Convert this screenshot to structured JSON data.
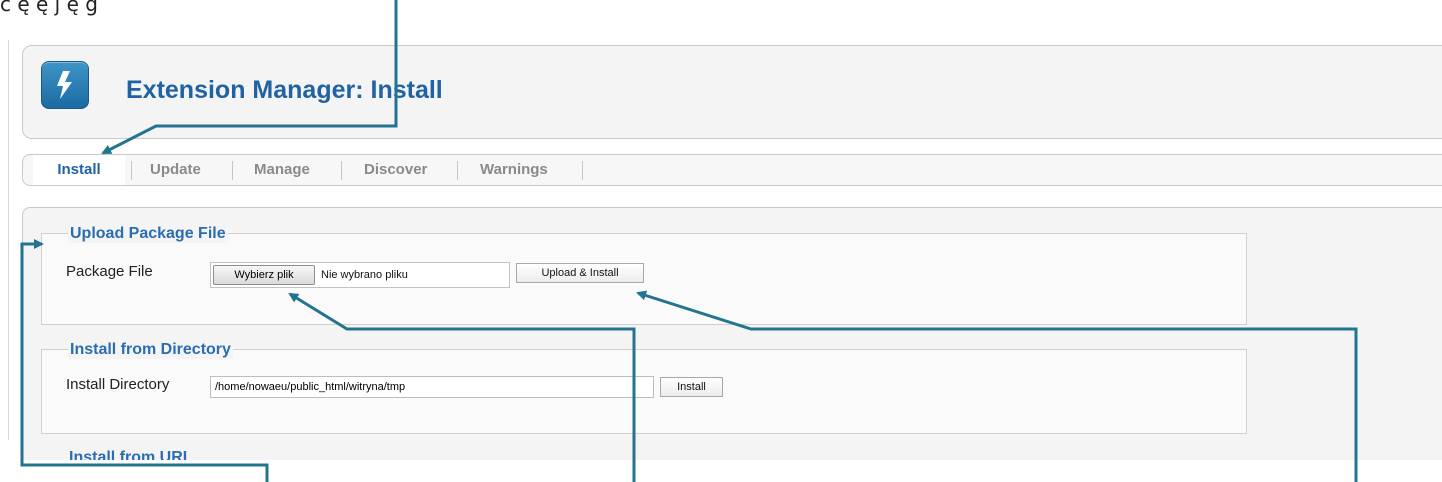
{
  "top_text": "ć ę ę j ę g",
  "header": {
    "title": "Extension Manager: Install",
    "logo_icon": "lightning-bolt-icon"
  },
  "tabs": [
    {
      "label": "Install",
      "active": true
    },
    {
      "label": "Update",
      "active": false
    },
    {
      "label": "Manage",
      "active": false
    },
    {
      "label": "Discover",
      "active": false
    },
    {
      "label": "Warnings",
      "active": false
    }
  ],
  "upload": {
    "legend": "Upload Package File",
    "field_label": "Package File",
    "choose_button": "Wybierz plik",
    "no_file_text": "Nie wybrano pliku",
    "submit_button": "Upload & Install"
  },
  "directory": {
    "legend": "Install from Directory",
    "field_label": "Install Directory",
    "value": "/home/nowaeu/public_html/witryna/tmp",
    "submit_button": "Install"
  },
  "url_section": {
    "legend": "Install from URL"
  },
  "colors": {
    "title_blue": "#1f63a3",
    "annotation_teal": "#23758f"
  }
}
